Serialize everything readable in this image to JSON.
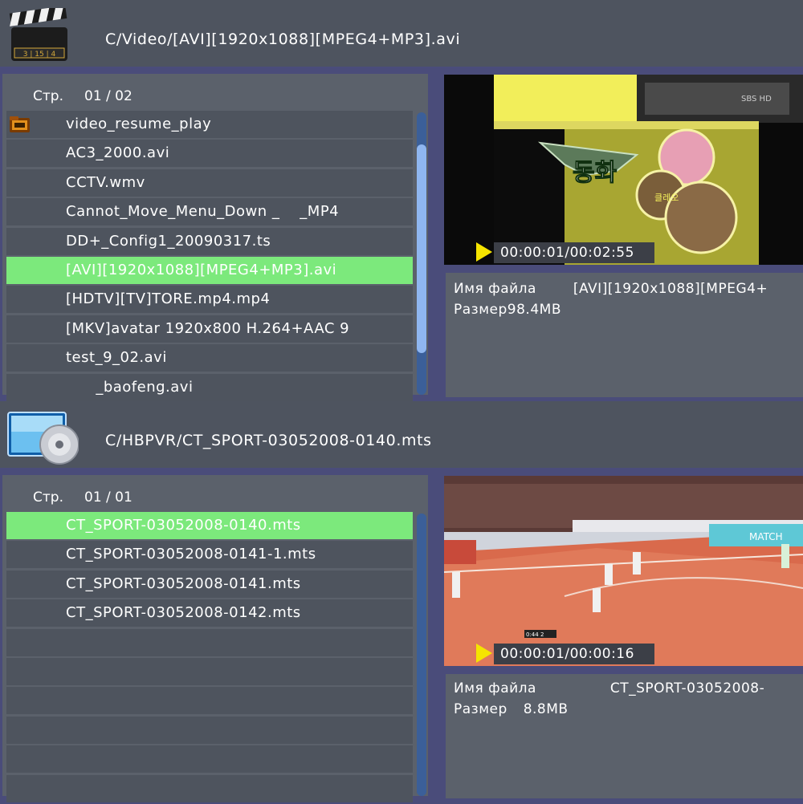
{
  "panel1": {
    "path": "C/Video/[AVI][1920x1088][MPEG4+MP3].avi",
    "page_label": "Стр.",
    "page_value": "01 / 02",
    "items": [
      {
        "label": "video_resume_play",
        "folder": true,
        "selected": false
      },
      {
        "label": "AC3_2000.avi",
        "folder": false,
        "selected": false
      },
      {
        "label": "CCTV.wmv",
        "folder": false,
        "selected": false
      },
      {
        "label": "Cannot_Move_Menu_Down _    _MP4",
        "folder": false,
        "selected": false
      },
      {
        "label": "DD+_Config1_20090317.ts",
        "folder": false,
        "selected": false
      },
      {
        "label": "[AVI][1920x1088][MPEG4+MP3].avi",
        "folder": false,
        "selected": true
      },
      {
        "label": "[HDTV][TV]TORE.mp4.mp4",
        "folder": false,
        "selected": false
      },
      {
        "label": "[MKV]avatar 1920x800 H.264+AAC 9",
        "folder": false,
        "selected": false
      },
      {
        "label": "test_9_02.avi",
        "folder": false,
        "selected": false
      },
      {
        "label": "      _baofeng.avi",
        "folder": false,
        "selected": false
      }
    ],
    "time": "00:00:01/00:02:55",
    "filename_label": "Имя файла",
    "filename_value": "[AVI][1920x1088][MPEG4+",
    "size_label": "Размер",
    "size_value": "98.4MB",
    "video_overlay": {
      "korean_title": "동화",
      "korean_sub": "클레오",
      "watermark": "SBS HD"
    },
    "clapper_text": "3 | 15 | 4"
  },
  "panel2": {
    "path": "C/HBPVR/CT_SPORT-03052008-0140.mts",
    "page_label": "Стр.",
    "page_value": "01 / 01",
    "items": [
      {
        "label": "CT_SPORT-03052008-0140.mts",
        "selected": true
      },
      {
        "label": "CT_SPORT-03052008-0141-1.mts",
        "selected": false
      },
      {
        "label": "CT_SPORT-03052008-0141.mts",
        "selected": false
      },
      {
        "label": "CT_SPORT-03052008-0142.mts",
        "selected": false
      },
      {
        "label": "",
        "selected": false
      },
      {
        "label": "",
        "selected": false
      },
      {
        "label": "",
        "selected": false
      },
      {
        "label": "",
        "selected": false
      },
      {
        "label": "",
        "selected": false
      },
      {
        "label": "",
        "selected": false
      }
    ],
    "time": "00:00:01/00:00:16",
    "filename_label": "Имя файла",
    "filename_value": "CT_SPORT-03052008-",
    "size_label": "Размер",
    "size_value": "8.8MB",
    "video_overlay": {
      "court_text": "MATCH",
      "scoreboard": "0:44  2"
    }
  },
  "colors": {
    "background": "#4a4c7a",
    "header": "#4e545f",
    "row": "#4e545e",
    "selected_row": "#7ce97c",
    "scrollbar": "#3b5f99",
    "play_icon": "#f5e400"
  },
  "icons": {
    "panel1_header": "clapperboard-icon",
    "panel2_header": "monitor-disc-icon",
    "folder": "folder-icon",
    "play": "play-icon"
  }
}
